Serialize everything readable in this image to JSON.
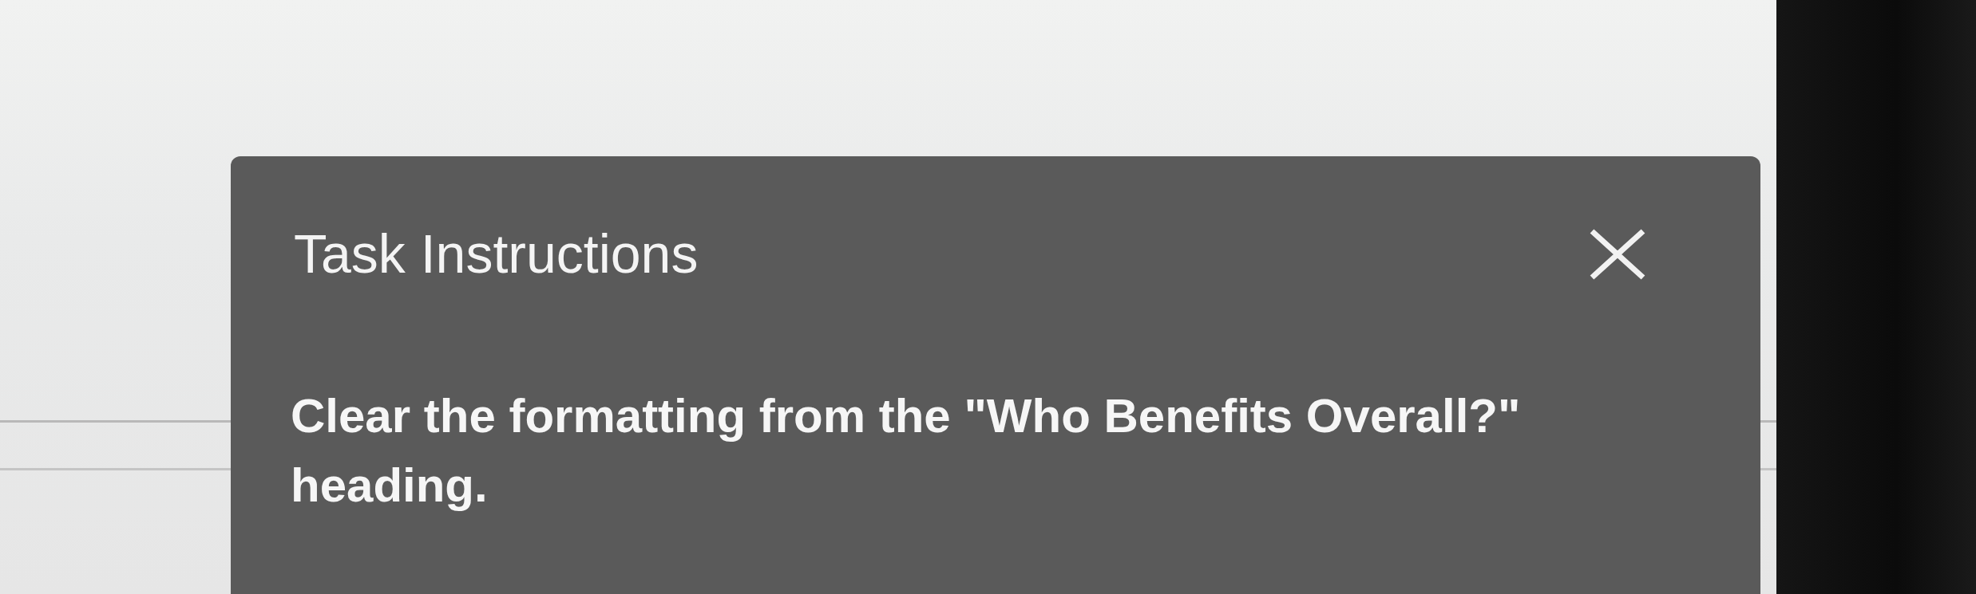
{
  "dialog": {
    "title": "Task Instructions",
    "instruction": "Clear the formatting from the \"Who Benefits Overall?\" heading."
  }
}
